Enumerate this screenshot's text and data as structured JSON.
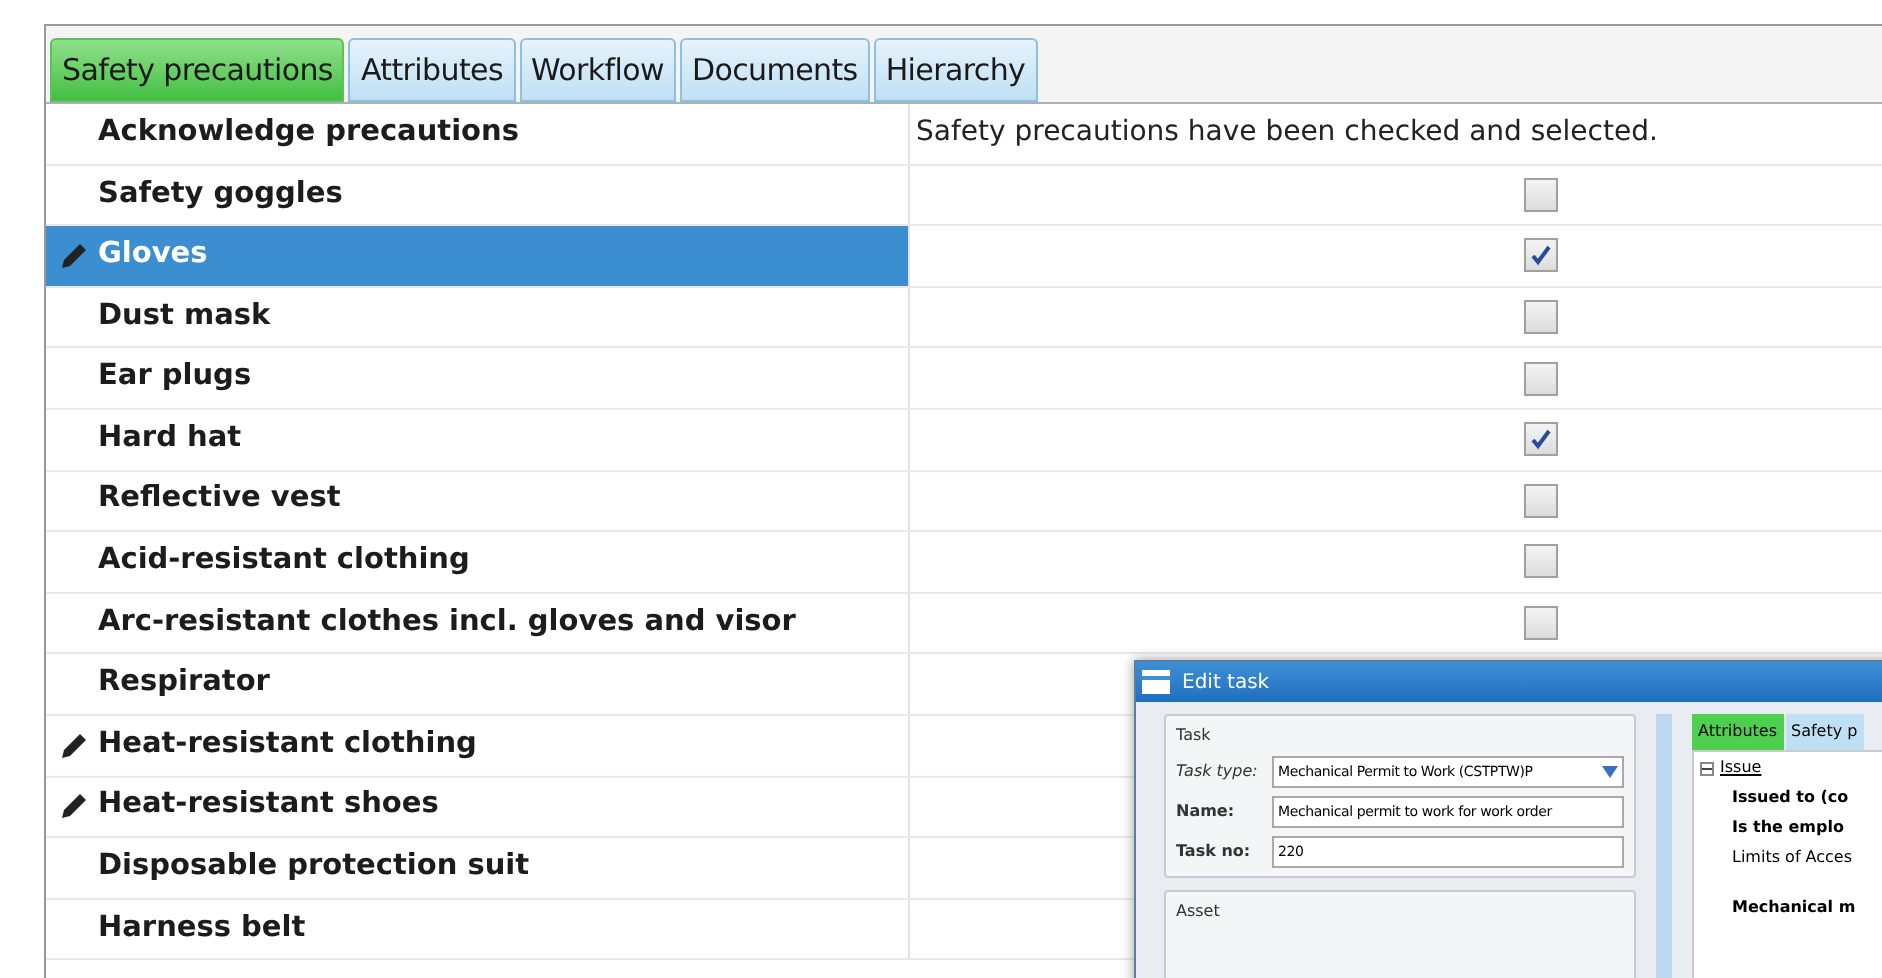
{
  "tabs": [
    {
      "label": "Safety precautions",
      "selected": true
    },
    {
      "label": "Attributes",
      "selected": false
    },
    {
      "label": "Workflow",
      "selected": false
    },
    {
      "label": "Documents",
      "selected": false
    },
    {
      "label": "Hierarchy",
      "selected": false
    }
  ],
  "rows": [
    {
      "kind": "text",
      "label": "Acknowledge precautions",
      "value": "Safety precautions have been checked and selected.",
      "selected": false,
      "edit": false
    },
    {
      "kind": "checkbox",
      "label": "Safety goggles",
      "checked": false,
      "selected": false,
      "edit": false
    },
    {
      "kind": "checkbox",
      "label": "Gloves",
      "checked": true,
      "selected": true,
      "edit": true
    },
    {
      "kind": "checkbox",
      "label": "Dust mask",
      "checked": false,
      "selected": false,
      "edit": false
    },
    {
      "kind": "checkbox",
      "label": "Ear plugs",
      "checked": false,
      "selected": false,
      "edit": false
    },
    {
      "kind": "checkbox",
      "label": "Hard hat",
      "checked": true,
      "selected": false,
      "edit": false
    },
    {
      "kind": "checkbox",
      "label": "Reflective vest",
      "checked": false,
      "selected": false,
      "edit": false
    },
    {
      "kind": "checkbox",
      "label": "Acid-resistant clothing",
      "checked": false,
      "selected": false,
      "edit": false
    },
    {
      "kind": "checkbox",
      "label": "Arc-resistant clothes incl. gloves and visor",
      "checked": false,
      "selected": false,
      "edit": false
    },
    {
      "kind": "label",
      "label": "Respirator",
      "selected": false,
      "edit": false
    },
    {
      "kind": "label",
      "label": "Heat-resistant clothing",
      "selected": false,
      "edit": true
    },
    {
      "kind": "label",
      "label": "Heat-resistant shoes",
      "selected": false,
      "edit": true
    },
    {
      "kind": "label",
      "label": "Disposable protection suit",
      "selected": false,
      "edit": false
    },
    {
      "kind": "label",
      "label": "Harness belt",
      "selected": false,
      "edit": false
    }
  ],
  "dialog": {
    "title": "Edit task",
    "task_group": {
      "title": "Task",
      "fields": [
        {
          "label": "Task type:",
          "value": "Mechanical Permit to Work (CSTPTW)P",
          "kind": "dropdown"
        },
        {
          "label": "Name:",
          "value": "Mechanical permit to work for work order",
          "kind": "text"
        },
        {
          "label": "Task no:",
          "value": "220",
          "kind": "text"
        }
      ]
    },
    "asset_group": {
      "title": "Asset"
    },
    "tabs": [
      {
        "label": "Attributes",
        "selected": true
      },
      {
        "label": "Safety p",
        "selected": false
      }
    ],
    "tree": {
      "title": "Issue",
      "expanded": true,
      "items": [
        {
          "text": "Issued to (co",
          "bold": true
        },
        {
          "text": "Is the emplo",
          "bold": true
        },
        {
          "text": "Limits of Acces",
          "bold": false
        },
        {
          "text": "Mechanical m",
          "bold": true
        }
      ]
    }
  }
}
